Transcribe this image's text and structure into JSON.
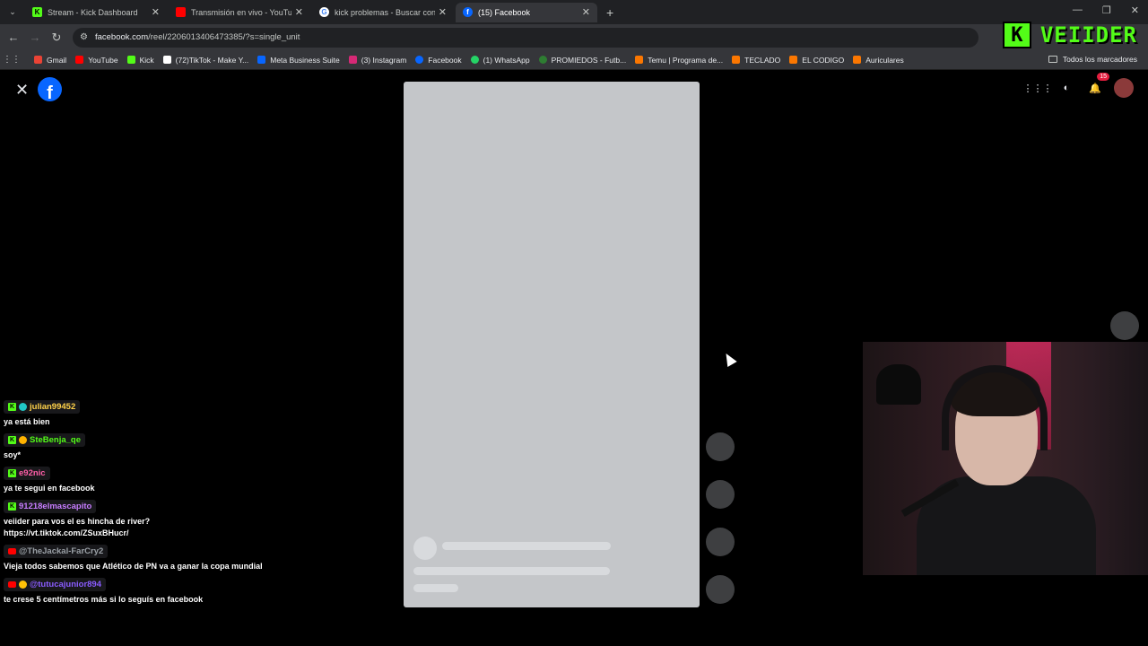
{
  "tabs": [
    {
      "title": "Stream - Kick Dashboard",
      "favicon": "kick-icon",
      "color": "#53fc18",
      "active": false
    },
    {
      "title": "Transmisión en vivo - YouTube",
      "favicon": "youtube-icon",
      "color": "#ff0000",
      "active": false
    },
    {
      "title": "kick problemas - Buscar con Go",
      "favicon": "google-icon",
      "color": "#ffffff",
      "active": false
    },
    {
      "title": "(15) Facebook",
      "favicon": "facebook-icon",
      "color": "#0866ff",
      "active": true
    }
  ],
  "address": {
    "host": "facebook.com",
    "path": "/reel/2206013406473385/?s=single_unit"
  },
  "overlay_brand": {
    "letter": "K",
    "name": "VEIIDER"
  },
  "bookmarks": [
    {
      "label": "Gmail",
      "color": "#ea4335"
    },
    {
      "label": "YouTube",
      "color": "#ff0000"
    },
    {
      "label": "Kick",
      "color": "#53fc18"
    },
    {
      "label": "(72)TikTok - Make Y...",
      "color": "#ffffff"
    },
    {
      "label": "Meta Business Suite",
      "color": "#0866ff"
    },
    {
      "label": "(3) Instagram",
      "color": "#d62976"
    },
    {
      "label": "Facebook",
      "color": "#0866ff"
    },
    {
      "label": "(1) WhatsApp",
      "color": "#25d366"
    },
    {
      "label": "PROMIEDOS - Futb...",
      "color": "#2e7d32"
    },
    {
      "label": "Temu | Programa de...",
      "color": "#fb7701"
    },
    {
      "label": "TECLADO",
      "color": "#fb7701"
    },
    {
      "label": "EL CODIGO",
      "color": "#fb7701"
    },
    {
      "label": "Auriculares",
      "color": "#fb7701"
    }
  ],
  "bookmarks_all": "Todos los marcadores",
  "facebook": {
    "logo_letter": "f",
    "notifications_count": "15"
  },
  "chat": [
    {
      "platform": "kick",
      "user": "julian99452",
      "user_color": "#ffd24a",
      "text": "ya está bien"
    },
    {
      "platform": "kick",
      "user": "SteBenja_qe",
      "user_color": "#53fc18",
      "text": "soy*"
    },
    {
      "platform": "kick",
      "user": "e92nic",
      "user_color": "#ff5fa8",
      "text": "ya te segui en facebook"
    },
    {
      "platform": "kick",
      "user": "91218elmascapito",
      "user_color": "#c77dff",
      "text": "veiider para vos el es hincha de river? https://vt.tiktok.com/ZSuxBHucr/"
    },
    {
      "platform": "youtube",
      "user": "@TheJackal-FarCry2",
      "user_color": "#9aa0a6",
      "text": "Vieja todos sabemos que Atlético de PN va a ganar la copa mundial"
    },
    {
      "platform": "youtube",
      "user": "@tutucajunior894",
      "user_color": "#8a5cff",
      "text": "te crese 5 centímetros más si lo seguís en facebook"
    }
  ]
}
